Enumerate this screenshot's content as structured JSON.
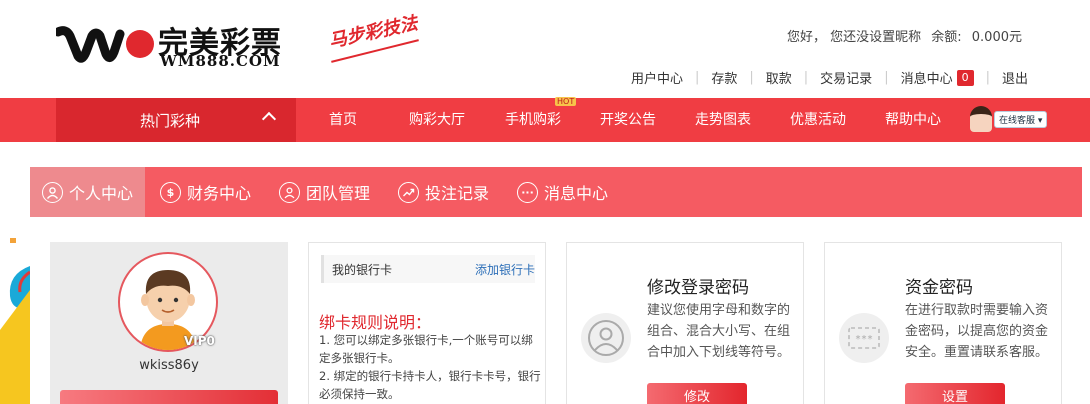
{
  "header": {
    "logo_cn": "完美彩票",
    "logo_en": "WM888.COM",
    "slogan": "马步彩技法",
    "greeting": "您好， 您还没设置昵称",
    "balance_label": "余额:",
    "balance_value": "0.000元",
    "links": {
      "user_center": "用户中心",
      "deposit": "存款",
      "withdraw": "取款",
      "records": "交易记录",
      "messages": "消息中心",
      "messages_count": "0",
      "logout": "退出"
    }
  },
  "nav": {
    "hot": "热门彩种",
    "items": {
      "home": "首页",
      "hall": "购彩大厅",
      "mobile": "手机购彩",
      "mobile_tag": "HOT",
      "draw": "开奖公告",
      "trend": "走势图表",
      "promo": "优惠活动",
      "help": "帮助中心"
    },
    "service": "在线客服"
  },
  "tabs": {
    "personal": "个人中心",
    "finance": "财务中心",
    "team": "团队管理",
    "bets": "投注记录",
    "messages": "消息中心"
  },
  "profile": {
    "vip": "VIP0",
    "username": "wkiss86y"
  },
  "bank": {
    "title": "我的银行卡",
    "add": "添加银行卡",
    "rule_title": "绑卡规则说明：",
    "rule_1": "1. 您可以绑定多张银行卡,一个账号可以绑定多张银行卡。",
    "rule_2": "2. 绑定的银行卡持卡人，银行卡卡号，银行必须保持一致。"
  },
  "password_card": {
    "title": "修改登录密码",
    "desc": "建议您使用字母和数字的组合、混合大小写、在组合中加入下划线等符号。",
    "button": "修改"
  },
  "fund_card": {
    "title": "资金密码",
    "desc": "在进行取款时需要输入资金密码，以提高您的资金安全。重置请联系客服。",
    "button": "设置"
  },
  "colors": {
    "brand_red": "#f03d43",
    "tab_bar": "#f55b62",
    "link_blue": "#2d6fb8"
  }
}
